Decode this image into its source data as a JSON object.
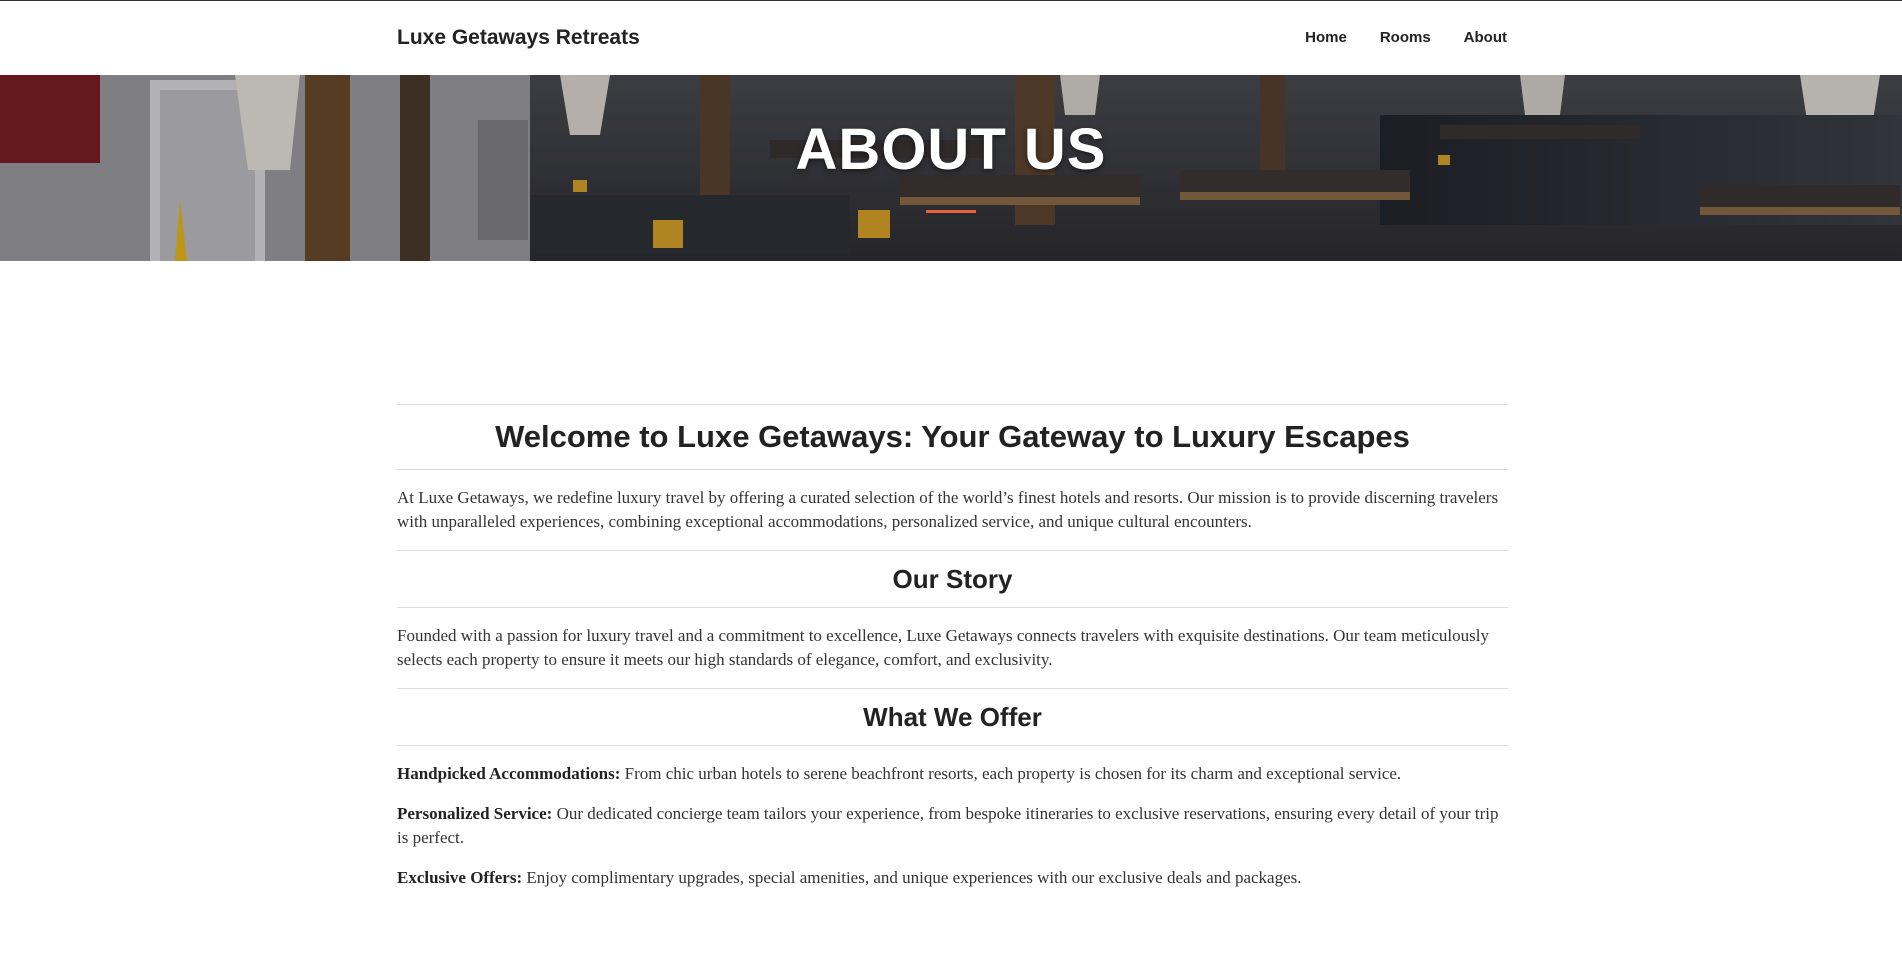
{
  "navbar": {
    "brand": "Luxe Getaways Retreats",
    "links": [
      {
        "label": "Home"
      },
      {
        "label": "Rooms"
      },
      {
        "label": "About"
      }
    ]
  },
  "hero": {
    "title": "ABOUT US",
    "accent_color": "#e8603c"
  },
  "content": {
    "welcome_heading": "Welcome to Luxe Getaways: Your Gateway to Luxury Escapes",
    "welcome_text": "At Luxe Getaways, we redefine luxury travel by offering a curated selection of the world’s finest hotels and resorts. Our mission is to provide discerning travelers with unparalleled experiences, combining exceptional accommodations, personalized service, and unique cultural encounters.",
    "story_heading": "Our Story",
    "story_text": "Founded with a passion for luxury travel and a commitment to excellence, Luxe Getaways connects travelers with exquisite destinations. Our team meticulously selects each property to ensure it meets our high standards of elegance, comfort, and exclusivity.",
    "offer_heading": "What We Offer",
    "offers": [
      {
        "title": "Handpicked Accommodations:",
        "text": " From chic urban hotels to serene beachfront resorts, each property is chosen for its charm and exceptional service."
      },
      {
        "title": "Personalized Service:",
        "text": " Our dedicated concierge team tailors your experience, from bespoke itineraries to exclusive reservations, ensuring every detail of your trip is perfect."
      },
      {
        "title": "Exclusive Offers:",
        "text": " Enjoy complimentary upgrades, special amenities, and unique experiences with our exclusive deals and packages."
      }
    ]
  }
}
